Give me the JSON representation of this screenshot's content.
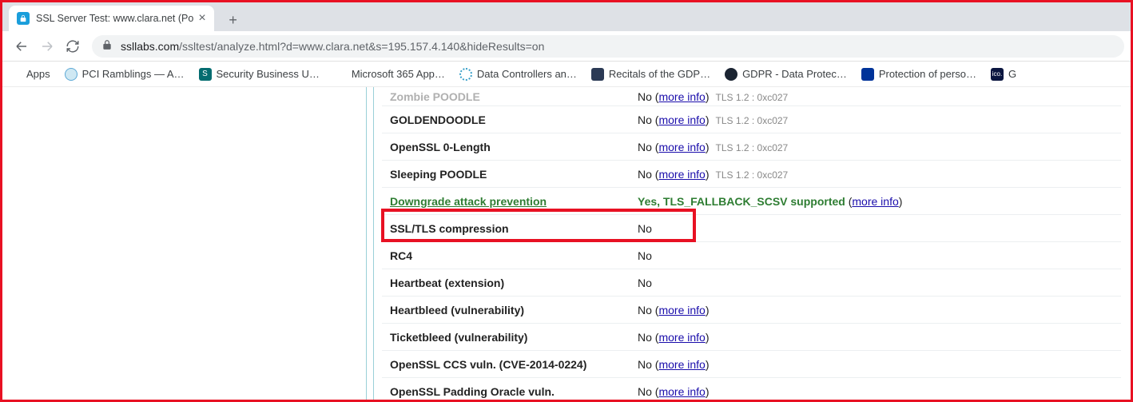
{
  "tab": {
    "title": "SSL Server Test: www.clara.net (Po"
  },
  "url": {
    "host": "ssllabs.com",
    "path": "/ssltest/analyze.html?d=www.clara.net&s=195.157.4.140&hideResults=on"
  },
  "bookmarks": [
    {
      "label": "Apps",
      "icon": "apps"
    },
    {
      "label": "PCI Ramblings — A…",
      "icon": "pci"
    },
    {
      "label": "Security Business U…",
      "icon": "sp"
    },
    {
      "label": "Microsoft 365 App…",
      "icon": "ms"
    },
    {
      "label": "Data Controllers an…",
      "icon": "dc"
    },
    {
      "label": "Recitals of the GDP…",
      "icon": "gdpr"
    },
    {
      "label": "GDPR - Data Protec…",
      "icon": "gdpr2"
    },
    {
      "label": "Protection of perso…",
      "icon": "eu"
    },
    {
      "label": "G",
      "icon": "ico"
    }
  ],
  "more_info": "more info",
  "rows": [
    {
      "label": "Zombie POODLE",
      "value": "No",
      "link": true,
      "meta": "TLS 1.2 : 0xc027",
      "cut": true
    },
    {
      "label": "GOLDENDOODLE",
      "value": "No",
      "link": true,
      "meta": "TLS 1.2 : 0xc027"
    },
    {
      "label": "OpenSSL 0-Length",
      "value": "No",
      "link": true,
      "meta": "TLS 1.2 : 0xc027"
    },
    {
      "label": "Sleeping POODLE",
      "value": "No",
      "link": true,
      "meta": "TLS 1.2 : 0xc027"
    },
    {
      "label": "Downgrade attack prevention",
      "value": "Yes, TLS_FALLBACK_SCSV supported",
      "green": true,
      "link": true
    },
    {
      "label": "SSL/TLS compression",
      "value": "No"
    },
    {
      "label": "RC4",
      "value": "No"
    },
    {
      "label": "Heartbeat (extension)",
      "value": "No"
    },
    {
      "label": "Heartbleed (vulnerability)",
      "value": "No",
      "link": true
    },
    {
      "label": "Ticketbleed (vulnerability)",
      "value": "No",
      "link": true
    },
    {
      "label": "OpenSSL CCS vuln. (CVE-2014-0224)",
      "value": "No",
      "link": true
    },
    {
      "label": "OpenSSL Padding Oracle vuln.",
      "value": "No",
      "link": true,
      "bottom_cut": true
    }
  ]
}
